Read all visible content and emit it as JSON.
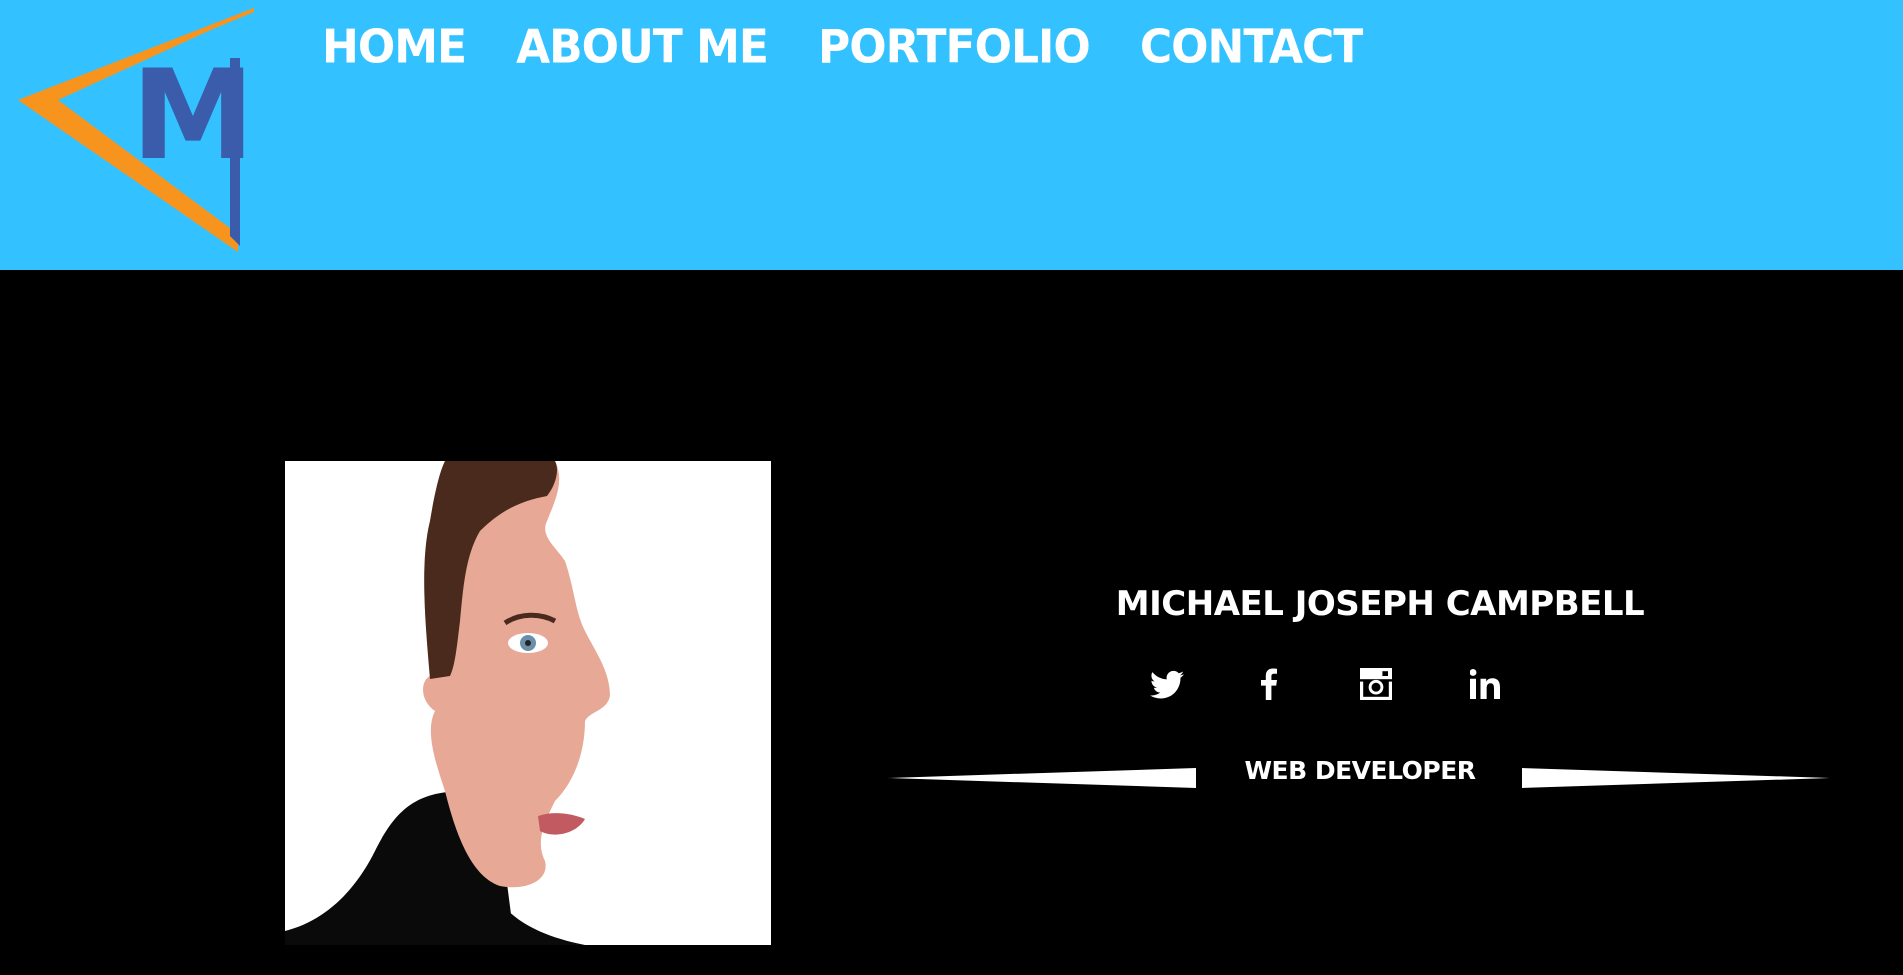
{
  "header": {
    "background_color": "#33c2ff",
    "logo": {
      "letter": "M",
      "colors": {
        "chevron": "#f7941d",
        "letter": "#3b5cab"
      }
    },
    "nav": [
      {
        "label": "Home"
      },
      {
        "label": "About Me"
      },
      {
        "label": "Portfolio"
      },
      {
        "label": "Contact"
      }
    ]
  },
  "profile": {
    "name": "MiCHAEL JOSEPH CAMPBELL",
    "role": "WEB DEVELOPER",
    "social": [
      {
        "icon": "twitter-icon"
      },
      {
        "icon": "facebook-icon"
      },
      {
        "icon": "instagram-icon"
      },
      {
        "icon": "linkedin-icon"
      }
    ]
  }
}
